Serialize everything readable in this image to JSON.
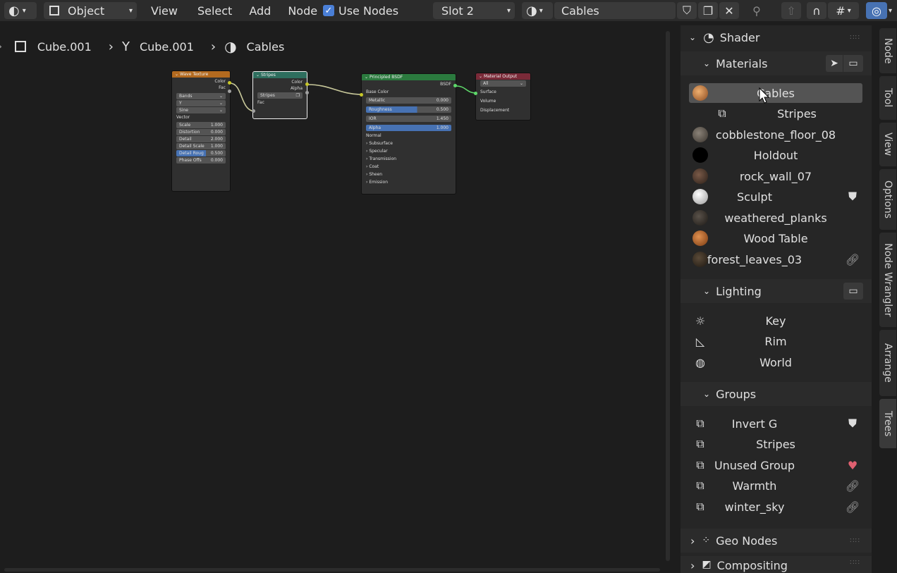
{
  "header": {
    "mode_label": "Object",
    "menus": [
      "View",
      "Select",
      "Add",
      "Node"
    ],
    "use_nodes_label": "Use Nodes",
    "slot_label": "Slot 2",
    "material_name": "Cables"
  },
  "breadcrumb": {
    "object": "Cube.001",
    "mesh": "Cube.001",
    "material": "Cables"
  },
  "nodes": {
    "wave": {
      "title": "Wave Texture",
      "outputs": [
        "Color",
        "Fac"
      ],
      "dropdowns": [
        "Bands",
        "Y",
        "Sine"
      ],
      "vector_label": "Vector",
      "fields": [
        {
          "label": "Scale",
          "value": "1.000"
        },
        {
          "label": "Distortion",
          "value": "0.000"
        },
        {
          "label": "Detail",
          "value": "2.000"
        },
        {
          "label": "Detail Scale",
          "value": "1.000"
        },
        {
          "label": "Detail Roug",
          "value": "0.500"
        },
        {
          "label": "Phase Offs",
          "value": "0.000"
        }
      ]
    },
    "stripes": {
      "title": "Stripes",
      "outputs": [
        "Color",
        "Alpha"
      ],
      "group_name": "Stripes",
      "input": "Fac"
    },
    "bsdf": {
      "title": "Principled BSDF",
      "output": "BSDF",
      "base_color": "Base Color",
      "fields": [
        {
          "label": "Metallic",
          "value": "0.000"
        },
        {
          "label": "Roughness",
          "value": "0.500"
        },
        {
          "label": "IOR",
          "value": "1.450"
        },
        {
          "label": "Alpha",
          "value": "1.000"
        }
      ],
      "normal": "Normal",
      "panels": [
        "Subsurface",
        "Specular",
        "Transmission",
        "Coat",
        "Sheen",
        "Emission"
      ]
    },
    "output": {
      "title": "Material Output",
      "target": "All",
      "inputs": [
        "Surface",
        "Volume",
        "Displacement"
      ]
    }
  },
  "panel": {
    "shader_title": "Shader",
    "materials_title": "Materials",
    "materials": [
      {
        "name": "Cables",
        "color": "#c07a3a"
      },
      {
        "name": "Stripes",
        "color": ""
      },
      {
        "name": "cobblestone_floor_08",
        "color": "#6a625a"
      },
      {
        "name": "Holdout",
        "color": "#000000"
      },
      {
        "name": "rock_wall_07",
        "color": "#5a4538"
      },
      {
        "name": "Sculpt",
        "color": "#d8d8d8"
      },
      {
        "name": "weathered_planks",
        "color": "#3a3530"
      },
      {
        "name": "Wood Table",
        "color": "#b0662a"
      },
      {
        "name": "forest_leaves_03",
        "color": "#3e3428"
      }
    ],
    "lighting_title": "Lighting",
    "lights": [
      {
        "name": "Key",
        "icon": "sun-icon"
      },
      {
        "name": "Rim",
        "icon": "area-light-icon"
      },
      {
        "name": "World",
        "icon": "world-icon"
      }
    ],
    "groups_title": "Groups",
    "groups": [
      {
        "name": "Invert G",
        "badge": "shield"
      },
      {
        "name": "Stripes",
        "badge": ""
      },
      {
        "name": "Unused Group",
        "badge": "heart"
      },
      {
        "name": "Warmth",
        "badge": "link"
      },
      {
        "name": "winter_sky",
        "badge": "link"
      }
    ],
    "geo_nodes_title": "Geo Nodes",
    "compositing_title": "Compositing"
  },
  "tabs": [
    "Node",
    "Tool",
    "View",
    "Options",
    "Node Wrangler",
    "Arrange",
    "Trees"
  ]
}
